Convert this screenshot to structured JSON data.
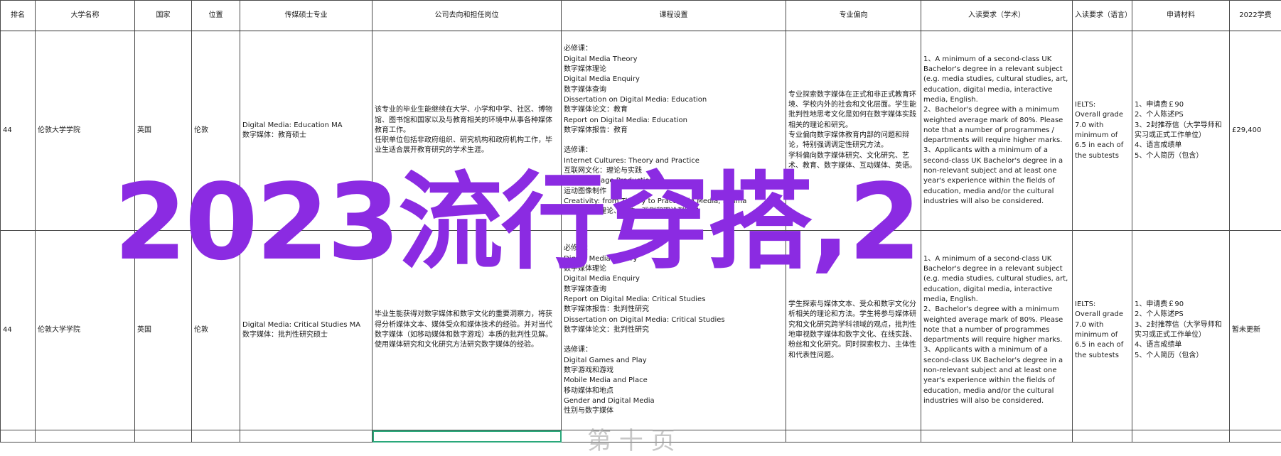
{
  "headers": [
    "排名",
    "大学名称",
    "国家",
    "位置",
    "传媒硕士专业",
    "公司去向和担任岗位",
    "课程设置",
    "专业偏向",
    "入读要求（学术）",
    "入读要求（语言）",
    "申请材料",
    "2022学费"
  ],
  "rows": [
    {
      "rank": "44",
      "university": "伦敦大学学院",
      "country": "英国",
      "location": "伦敦",
      "program": "Digital Media: Education MA\n数字媒体：教育硕士",
      "careers": "该专业的毕业生能继续在大学、小学和中学、社区、博物馆、图书馆和国家以及与教育相关的环境中从事各种媒体教育工作。\n任职单位包括非政府组织、研究机构和政府机构工作，毕业生适合展开教育研究的学术生涯。",
      "courses": "必修课：\nDigital Media Theory\n数字媒体理论\nDigital Media Enquiry\n数字媒体查询\nDissertation on Digital Media: Education\n数字媒体论文：教育\nReport on Digital Media: Education\n数字媒体报告：教育\n\n选修课：\nInternet Cultures: Theory and Practice\n互联网文化：理论与实践\nMoving Image Production\n运动图像制作\nCreativity: from Theory to Practice in Media, Drama\n创造力：从理论、媒体、戏剧和理论到实践",
      "focus": "专业探索数字媒体在正式和非正式教育环境、学校内外的社会和文化层面。学生能批判性地思考文化是如何在数字媒体实践相关的理论和研究。\n专业偏向数字媒体教育内部的问题和辩论，特别强调调定性研究方法。\n学科偏向数字媒体研究、文化研究、艺术、教育、数字媒体、互动媒体、英语。",
      "academic": "1、A minimum of a second-class UK Bachelor's degree in a relevant subject (e.g. media studies, cultural studies, art, education, digital media, interactive media, English.\n2、Bachelor's degree with a minimum weighted average mark of 80%. Please note that a number of programmes / departments will require higher marks.\n3、Applicants with a minimum of a second-class UK Bachelor's degree in a non-relevant subject and at least one year's experience within the fields of education, media and/or the cultural industries will also be considered.",
      "language": "IELTS:\nOverall grade 7.0 with minimum of 6.5 in each of the subtests",
      "materials": "1、申请费￡90\n2、个人陈述PS\n3、2封推荐信（大学导师和实习或正式工作单位）\n4、语言成绩单\n5、个人简历（包含）",
      "fee": "£29,400"
    },
    {
      "rank": "44",
      "university": "伦敦大学学院",
      "country": "英国",
      "location": "伦敦",
      "program": "Digital Media: Critical Studies MA\n数字媒体：批判性研究硕士",
      "careers": "毕业生能获得对数字媒体和数字文化的重要洞察力，将获得分析媒体文本、媒体受众和媒体技术的经验。并对当代数字媒体（如移动媒体和数字游戏）本质的批判性见解。使用媒体研究和文化研究方法研究数字媒体的经验。",
      "courses": "必修课：\nDigital Media Theory\n数字媒体理论\nDigital Media Enquiry\n数字媒体查询\nReport on Digital Media: Critical Studies\n数字媒体报告：批判性研究\nDissertation on Digital Media: Critical Studies\n数字媒体论文：批判性研究\n\n选修课：\nDigital Games and Play\n数字游戏和游戏\nMobile Media and Place\n移动媒体和地点\nGender and Digital Media\n性别与数字媒体",
      "focus": "学生探索与媒体文本、受众和数字文化分析相关的理论和方法。学生将参与媒体研究和文化研究跨学科领域的观点，批判性地审视数字媒体和数字文化、在线实践、粉丝和文化研究。同时探索权力、主体性和代表性问题。",
      "academic": "1、A minimum of a second-class UK Bachelor's degree in a relevant subject (e.g. media studies, cultural studies, art, education, digital media, interactive media, English.\n2、Bachelor's degree with a minimum weighted average mark of 80%. Please note that a number of programmes departments will require higher marks.\n3、Applicants with a minimum of a second-class UK Bachelor's degree in a non-relevant subject and at least one year's experience within the fields of education, media and/or the cultural industries will also be considered.",
      "language": "IELTS:\nOverall grade 7.0 with minimum of 6.5 in each of the subtests",
      "materials": "1、申请费￡90\n2、个人陈述PS\n3、2封推荐信（大学导师和实习或正式工作单位）\n4、语言成绩单\n5、个人简历（包含）",
      "fee": "暂未更新"
    }
  ],
  "overlay_text": "2023流行穿搭,2",
  "ghost_text": "第 十 页",
  "colors": {
    "overlay": "#8b2be2",
    "selection": "#2aa87a",
    "grid": "#4a4a4a"
  }
}
